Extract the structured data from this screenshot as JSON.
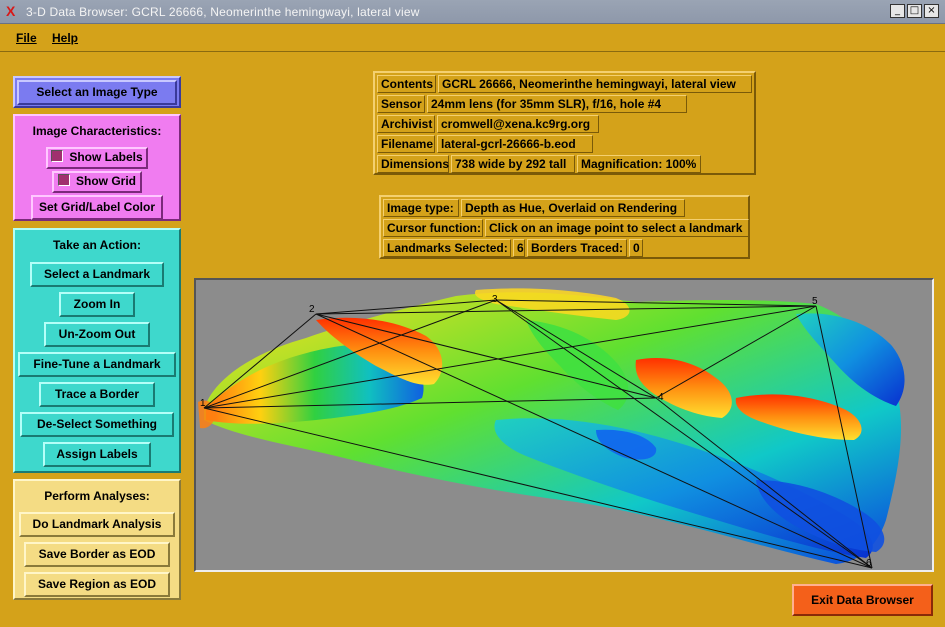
{
  "window": {
    "title": "3-D Data Browser:   GCRL 26666, Neomerinthe hemingwayi, lateral view",
    "buttons": [
      "_",
      "□",
      "×"
    ]
  },
  "menu": {
    "file": "File",
    "help": "Help"
  },
  "select_panel": {
    "button": "Select an Image Type"
  },
  "characteristics": {
    "title": "Image Characteristics:",
    "show_labels": "Show Labels",
    "show_grid": "Show Grid",
    "set_color": "Set Grid/Label Color"
  },
  "actions": {
    "title": "Take an Action:",
    "select_landmark": "Select a Landmark",
    "zoom_in": "Zoom In",
    "unzoom": "Un-Zoom Out",
    "fine_tune": "Fine-Tune a Landmark",
    "trace_border": "Trace a Border",
    "deselect": "De-Select Something",
    "assign_labels": "Assign Labels"
  },
  "analyses": {
    "title": "Perform Analyses:",
    "landmark_analysis": "Do Landmark Analysis",
    "save_border": "Save Border as EOD",
    "save_region": "Save Region as EOD"
  },
  "info": {
    "contents_label": "Contents",
    "contents_value": "GCRL 26666, Neomerinthe hemingwayi, lateral view",
    "sensor_label": "Sensor",
    "sensor_value": "24mm lens (for 35mm SLR), f/16, hole #4",
    "archivist_label": "Archivist",
    "archivist_value": "cromwell@xena.kc9rg.org",
    "filename_label": "Filename",
    "filename_value": "lateral-gcrl-26666-b.eod",
    "dimensions_label": "Dimensions",
    "dimensions_value": "738 wide by 292 tall",
    "magnification": "Magnification: 100%"
  },
  "status": {
    "image_type_label": "Image type:",
    "image_type_value": "Depth as Hue, Overlaid on Rendering",
    "cursor_label": "Cursor function:",
    "cursor_value": "Click on an image point to select a landmark",
    "landmarks_label": "Landmarks Selected:",
    "landmarks_value": "6",
    "borders_label": "Borders Traced:",
    "borders_value": "0"
  },
  "landmarks": [
    "1",
    "2",
    "3",
    "4",
    "5",
    "6"
  ],
  "exit": "Exit Data Browser",
  "colors": {
    "background": "#d4a21a",
    "select_panel": "#7b7bf0",
    "characteristics_panel": "#f07cf0",
    "actions_panel": "#3ed8cc",
    "analyses_panel": "#f4dc84",
    "exit_button": "#f4601a"
  }
}
